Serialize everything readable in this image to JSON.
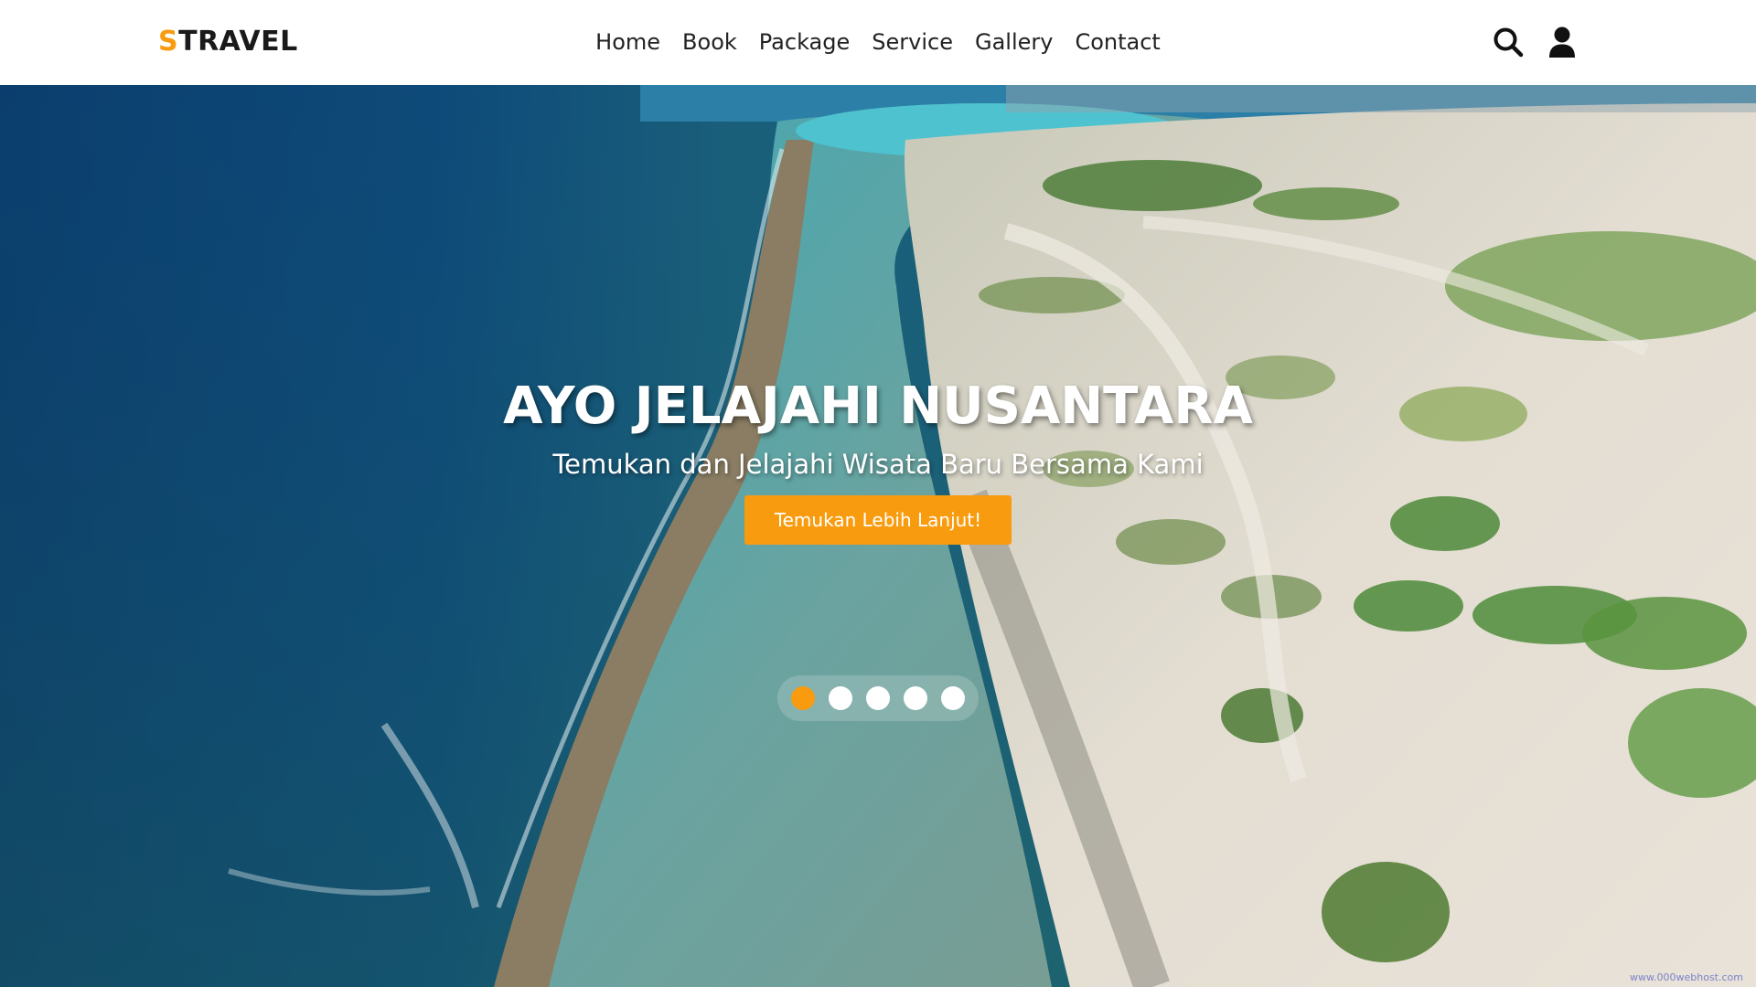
{
  "header": {
    "logo_first_letter": "S",
    "logo_rest": "TRAVEL",
    "nav_items": [
      "Home",
      "Book",
      "Package",
      "Service",
      "Gallery",
      "Contact"
    ],
    "icons": [
      "search-icon",
      "user-icon"
    ]
  },
  "hero": {
    "title": "AYO JELAJAHI NUSANTARA",
    "subtitle": "Temukan dan Jelajahi Wisata Baru Bersama Kami",
    "cta_label": "Temukan Lebih Lanjut!",
    "slide_count": 5,
    "active_slide": 1,
    "watermark": "www.000webhost.com"
  },
  "colors": {
    "accent": "#f99b0e",
    "header_bg": "#ffffff",
    "text_dark": "#222222"
  }
}
